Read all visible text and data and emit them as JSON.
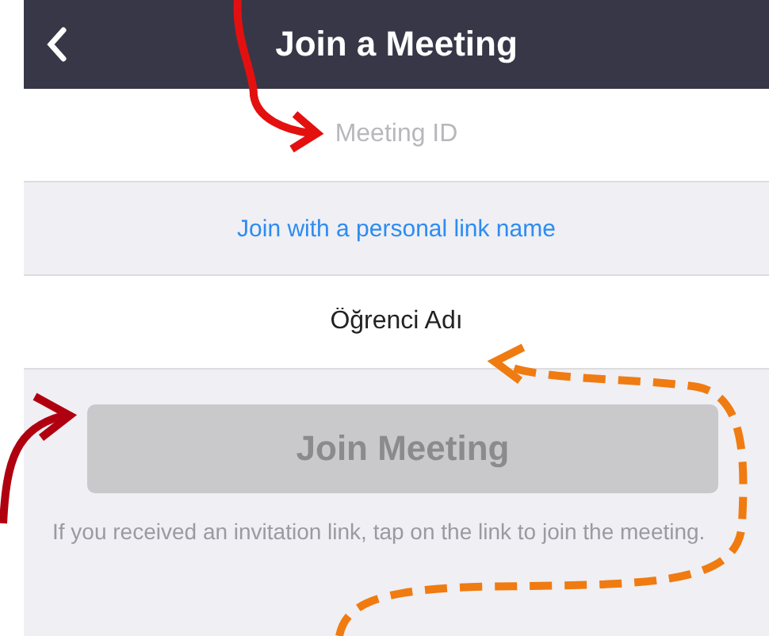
{
  "header": {
    "title": "Join a Meeting"
  },
  "meeting_id_field": {
    "placeholder": "Meeting ID"
  },
  "personal_link": "Join with a personal link name",
  "name_field": {
    "value": "Öğrenci Adı"
  },
  "join_button": {
    "label": "Join Meeting",
    "disabled": true
  },
  "note": "If you received an invitation link, tap on the link to join the meeting."
}
